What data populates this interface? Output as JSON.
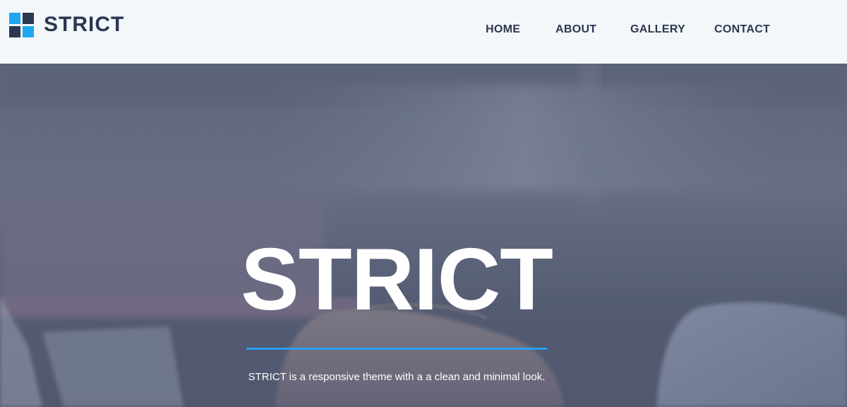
{
  "colors": {
    "header_bg": "#f4f7f9",
    "brand_dark": "#2c3750",
    "brand_blue": "#1ea7f0",
    "nav_text": "#2c3750",
    "hero_text": "#ffffff",
    "divider": "#2a9ff2"
  },
  "header": {
    "logo": {
      "icon": "four-squares-logo-icon",
      "text": "STRICT"
    },
    "nav": {
      "home": "HOME",
      "about": "ABOUT",
      "gallery": "GALLERY",
      "contact": "CONTACT"
    }
  },
  "hero": {
    "background": "blurred-office-hands-on-laptop-photo",
    "title": "STRICT",
    "subtitle": "STRICT is a responsive theme with a a clean and minimal look."
  }
}
